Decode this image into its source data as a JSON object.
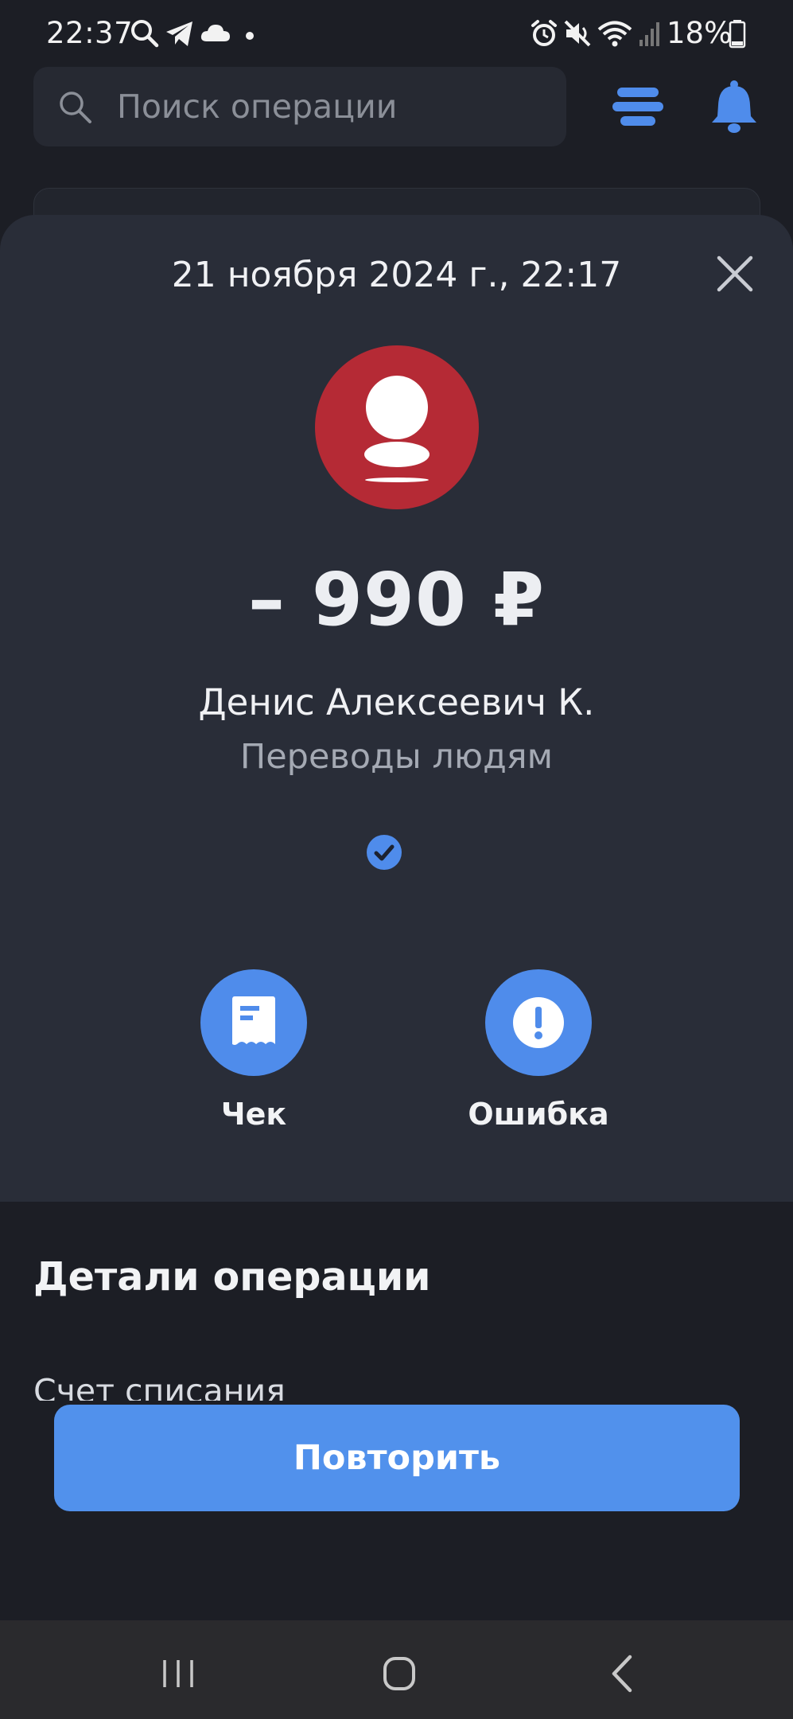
{
  "status_bar": {
    "time": "22:37",
    "battery": "18%",
    "left_icons": [
      "search-icon",
      "telegram-icon",
      "cloud-icon",
      "dot-icon"
    ],
    "right_icons": [
      "alarm-icon",
      "mute-icon",
      "wifi-icon",
      "signal-icon",
      "battery-icon"
    ]
  },
  "header": {
    "search_placeholder": "Поиск операции",
    "icons": [
      "filter-icon",
      "bell-icon"
    ]
  },
  "sheet": {
    "date": "21 ноября 2024 г., 22:17",
    "amount": "– 990 ₽",
    "recipient": "Денис Алексеевич К.",
    "category": "Переводы людям",
    "actions": [
      {
        "label": "Чек",
        "icon": "receipt-icon"
      },
      {
        "label": "Ошибка",
        "icon": "exclamation-icon"
      }
    ]
  },
  "details": {
    "title": "Детали операции",
    "first_field": "Счет списания"
  },
  "repeat_label": "Повторить",
  "colors": {
    "accent": "#4f8ceb",
    "avatar": "#b52a35",
    "sheet_bg": "#292d38",
    "page_bg": "#1c1e25"
  }
}
